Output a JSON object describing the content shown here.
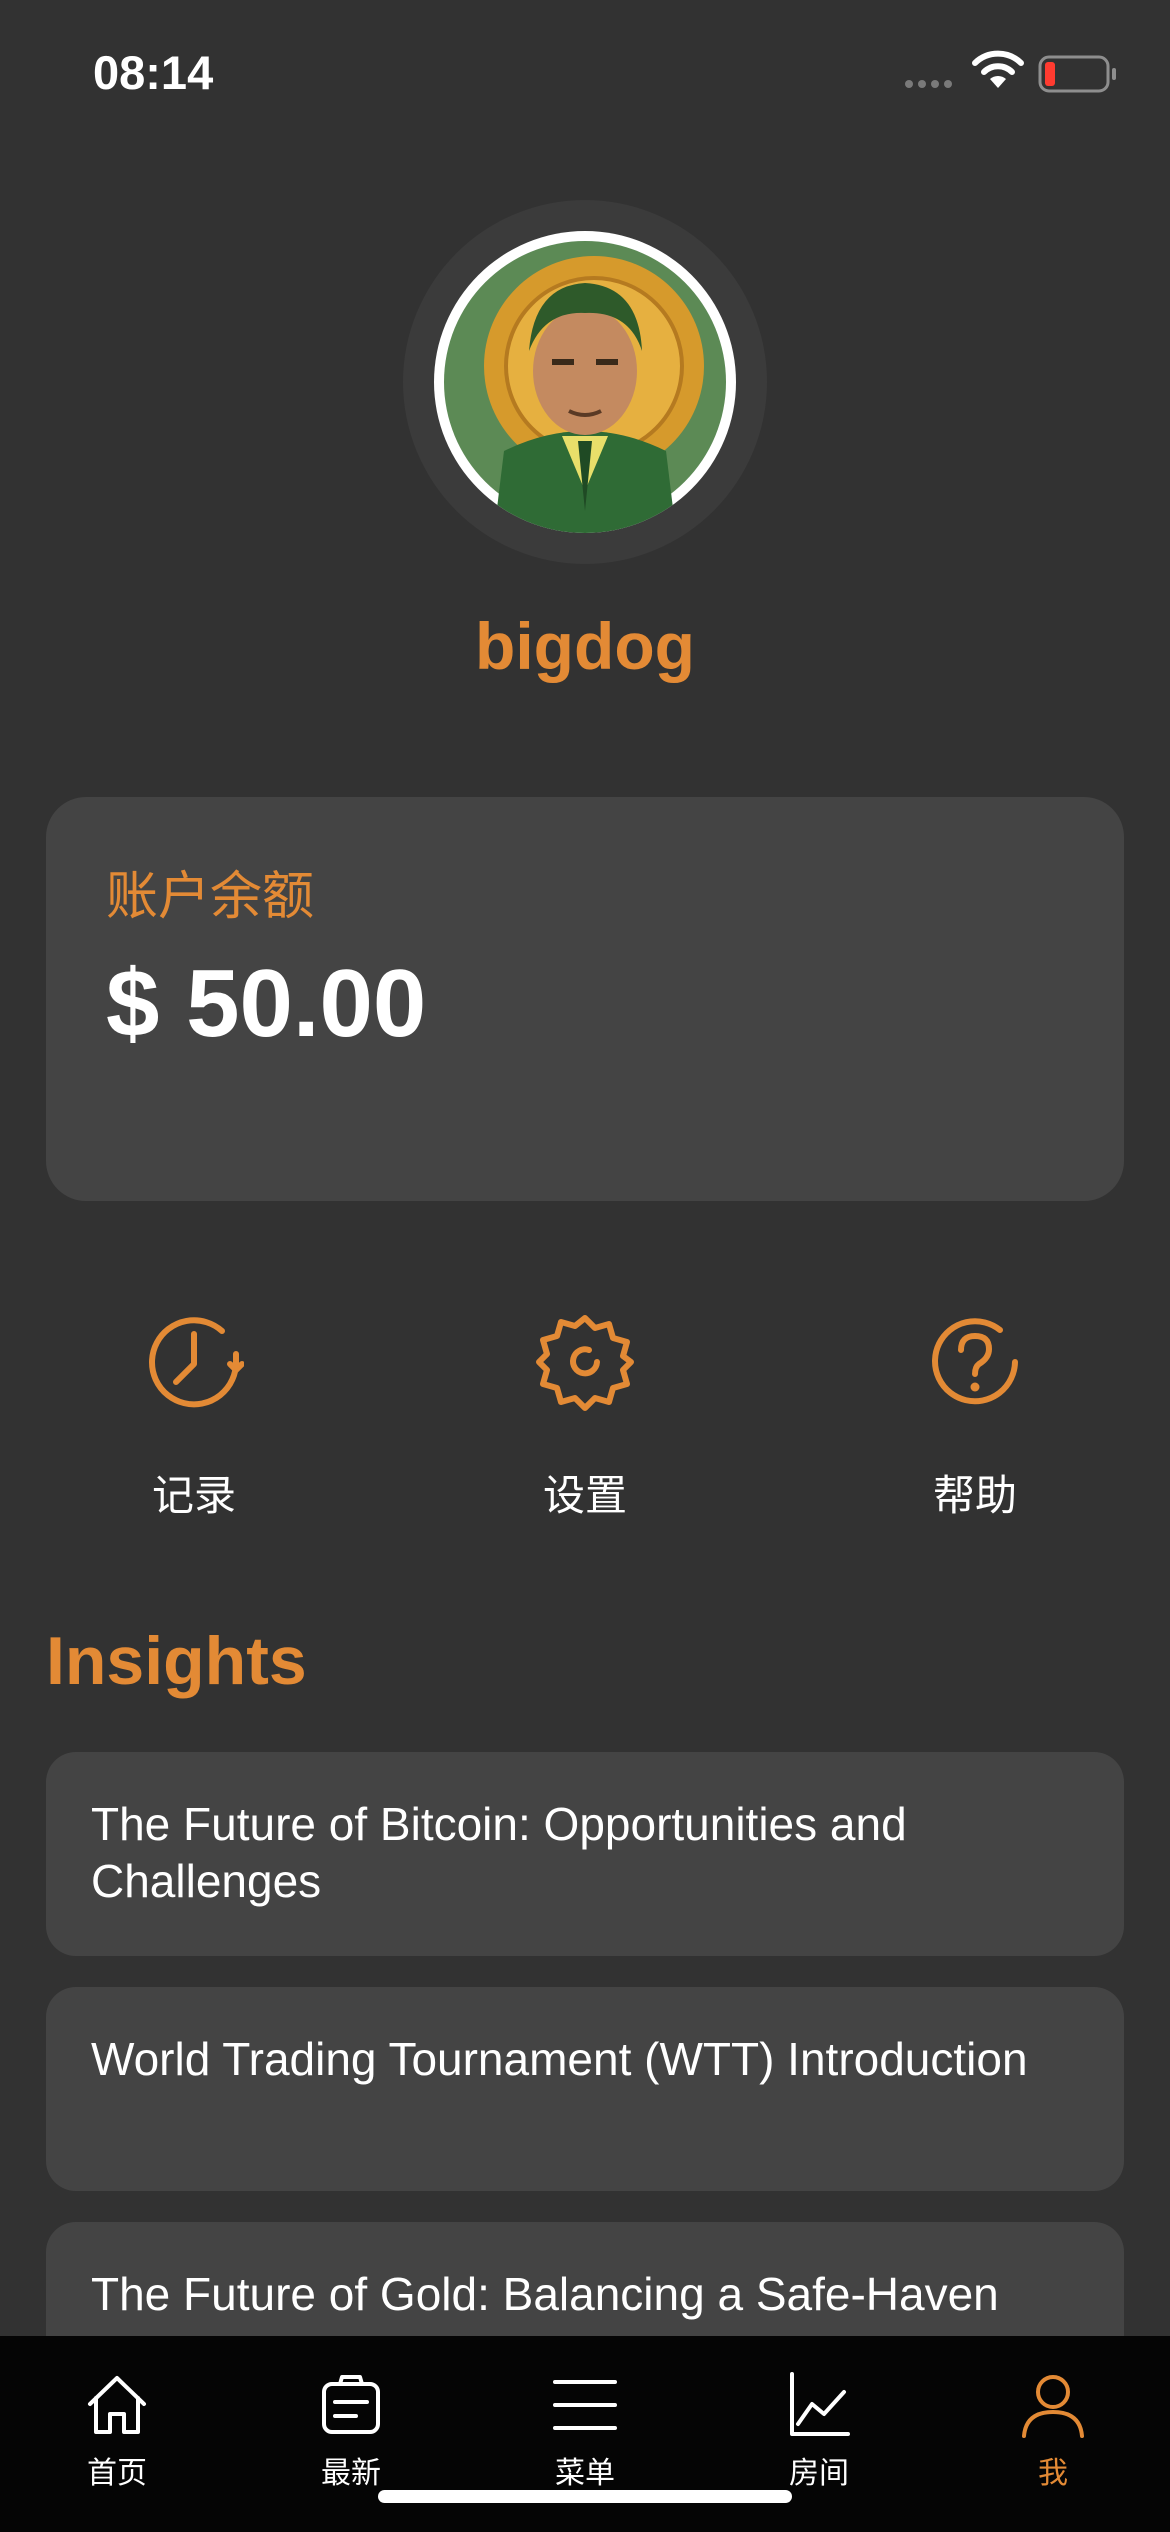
{
  "status_bar": {
    "time": "08:14"
  },
  "profile": {
    "username": "bigdog"
  },
  "balance": {
    "label": "账户余额",
    "value": "$ 50.00"
  },
  "actions": [
    {
      "label": "记录",
      "icon": "history-clock-icon"
    },
    {
      "label": "设置",
      "icon": "gear-icon"
    },
    {
      "label": "帮助",
      "icon": "help-circle-icon"
    }
  ],
  "insights": {
    "title": "Insights",
    "items": [
      {
        "text": "The Future of Bitcoin: Opportunities and Challenges"
      },
      {
        "text": "World Trading Tournament (WTT) Introduction"
      },
      {
        "text": "The Future of Gold: Balancing a Safe-Haven"
      }
    ]
  },
  "tab_bar": {
    "active_index": 4,
    "items": [
      {
        "label": "首页",
        "icon": "home-icon"
      },
      {
        "label": "最新",
        "icon": "news-icon"
      },
      {
        "label": "菜单",
        "icon": "menu-icon"
      },
      {
        "label": "房间",
        "icon": "chart-icon"
      },
      {
        "label": "我",
        "icon": "user-icon"
      }
    ]
  },
  "colors": {
    "accent": "#e38a35",
    "background": "#323232",
    "card": "#444444",
    "tab_bar": "#050505"
  }
}
